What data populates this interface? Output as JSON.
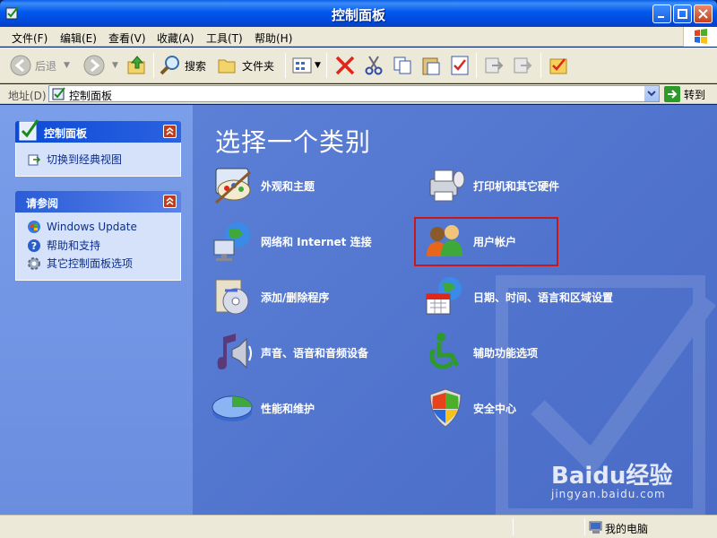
{
  "window": {
    "title": "控制面板"
  },
  "menu": [
    "文件(F)",
    "编辑(E)",
    "查看(V)",
    "收藏(A)",
    "工具(T)",
    "帮助(H)"
  ],
  "toolbar": {
    "back": "后退",
    "search": "搜索",
    "folders": "文件夹"
  },
  "address": {
    "label": "地址(D)",
    "value": "控制面板",
    "go": "转到"
  },
  "leftpane": {
    "panel1": {
      "title": "控制面板",
      "links": [
        "切换到经典视图"
      ]
    },
    "panel2": {
      "title": "请参阅",
      "links": [
        "Windows Update",
        "帮助和支持",
        "其它控制面板选项"
      ]
    }
  },
  "main": {
    "title": "选择一个类别",
    "categories": [
      "外观和主题",
      "打印机和其它硬件",
      "网络和 Internet 连接",
      "用户帐户",
      "添加/删除程序",
      "日期、时间、语言和区域设置",
      "声音、语音和音频设备",
      "辅助功能选项",
      "性能和维护",
      "安全中心"
    ]
  },
  "watermark": {
    "brand": "Baidu经验",
    "url": "jingyan.baidu.com"
  },
  "status": {
    "location": "我的电脑"
  },
  "colors": {
    "titlebar": "#0058ee",
    "main_bg": "#5578d2",
    "highlight": "#c81818",
    "link": "#0c2e8c"
  }
}
